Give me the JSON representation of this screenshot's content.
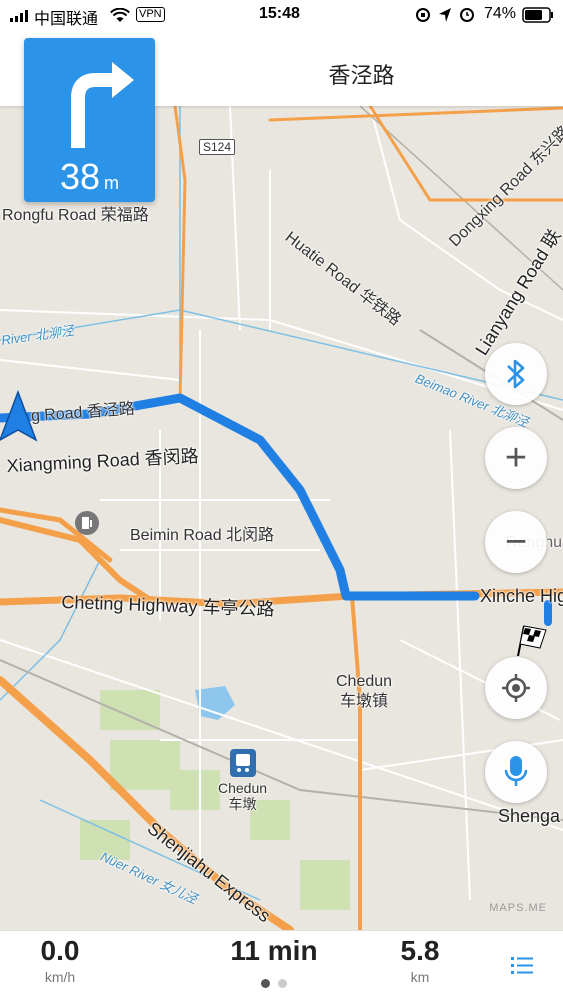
{
  "status_bar": {
    "carrier": "中国联通",
    "vpn": "VPN",
    "time": "15:48",
    "battery": "74%"
  },
  "instruction": {
    "distance": "38",
    "unit": "m",
    "street": "香泾路"
  },
  "map": {
    "road_labels": [
      {
        "id": "s124",
        "text": "S124"
      },
      {
        "id": "rongfu",
        "text": "Rongfu Road  荣福路"
      },
      {
        "id": "huatie",
        "text": "Huatie Road  华铁路"
      },
      {
        "id": "dongxing",
        "text": "Dongxing Road  东兴路"
      },
      {
        "id": "lianyang",
        "text": "Lianyang Road  联"
      },
      {
        "id": "xiangjing",
        "text": "g Road  香泾路"
      },
      {
        "id": "xiangming",
        "text": "Xiangming Road  香闵路"
      },
      {
        "id": "beimin",
        "text": "Beimin Road  北闵路"
      },
      {
        "id": "cheting",
        "text": "Cheting Highway  车亭公路"
      },
      {
        "id": "xinche",
        "text": "Xinche Hig"
      },
      {
        "id": "chedun_town",
        "text": "Chedun\n车墩镇"
      },
      {
        "id": "chedun_station",
        "text": "Chedun\n车墩"
      },
      {
        "id": "shenjiahu",
        "text": "Shenjiahu Express"
      },
      {
        "id": "shenga",
        "text": "Shenga"
      },
      {
        "id": "renghua",
        "text": "Renghua"
      }
    ],
    "river_labels": [
      {
        "id": "beimiao",
        "text": "Beimao River  北泖泾"
      },
      {
        "id": "river_left",
        "text": "River  北泖泾"
      },
      {
        "id": "nuer",
        "text": "Nüer River  女儿泾"
      }
    ],
    "credit": "MAPS.ME"
  },
  "buttons": {
    "bluetooth": "bluetooth-icon",
    "zoom_in": "+",
    "zoom_out": "−",
    "locate": "locate-icon",
    "voice": "microphone-icon"
  },
  "trip": {
    "speed": "0.0",
    "speed_unit": "km/h",
    "time": "11 min",
    "distance": "5.8",
    "distance_unit": "km",
    "page_indicator": {
      "count": 2,
      "active": 0
    }
  },
  "colors": {
    "route": "#1f7fe3",
    "accent": "#2b93e8",
    "highway": "#f4a04a",
    "river": "#5fb2d9"
  }
}
